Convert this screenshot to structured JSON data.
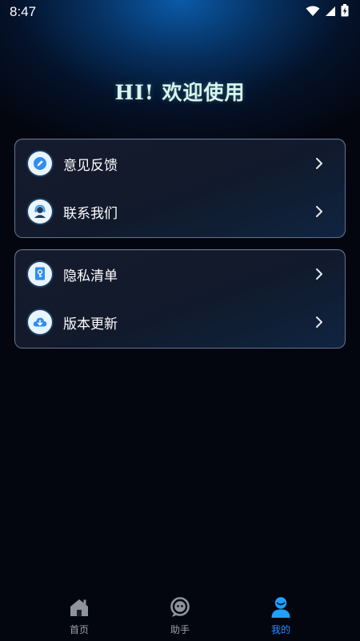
{
  "status_bar": {
    "time": "8:47"
  },
  "header": {
    "welcome": "HI! 欢迎使用"
  },
  "cards": [
    {
      "items": [
        {
          "label": "意见反馈",
          "icon": "pencil-icon"
        },
        {
          "label": "联系我们",
          "icon": "support-agent-icon"
        }
      ]
    },
    {
      "items": [
        {
          "label": "隐私清单",
          "icon": "lock-document-icon"
        },
        {
          "label": "版本更新",
          "icon": "cloud-download-icon"
        }
      ]
    }
  ],
  "tabbar": {
    "tabs": [
      {
        "label": "首页",
        "icon": "home-icon",
        "active": false
      },
      {
        "label": "助手",
        "icon": "assistant-bot-icon",
        "active": false
      },
      {
        "label": "我的",
        "icon": "profile-icon",
        "active": true
      }
    ]
  },
  "colors": {
    "accent": "#2f8cff",
    "inactive_tab": "#9aa0aa",
    "background": "#03060f",
    "welcome_text": "#d9f3ee"
  }
}
